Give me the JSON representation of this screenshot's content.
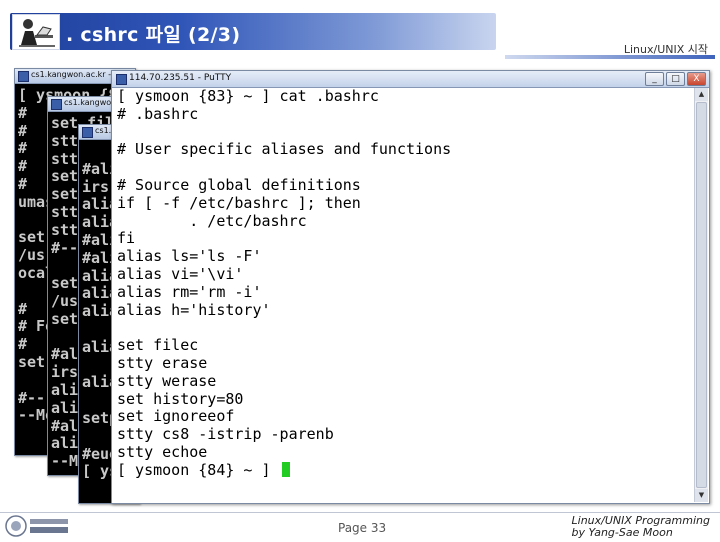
{
  "slide": {
    "title": ". cshrc 파일 (2/3)",
    "course": "Linux/UNIX 시작",
    "page": "Page 33",
    "credit_line1": "Linux/UNIX Programming",
    "credit_line2": "by Yang-Sae Moon"
  },
  "back_windows": [
    {
      "title": "cs1.kangwon.ac.kr - PuTTY",
      "lines": [
        "[ ysmoon {8",
        "#",
        "#",
        "#",
        "#",
        "#",
        "umas",
        "",
        "set",
        "/us",
        "ocal",
        "",
        "#",
        "# Fo",
        "#",
        "set",
        "",
        "#--",
        "--Mo"
      ]
    },
    {
      "title": "cs1.kangwon.ac.kr - PuTTY",
      "lines": [
        "set fil",
        "stty",
        "stty",
        "set",
        "set",
        "stt",
        "stt",
        "#--",
        "",
        "set",
        "/us",
        "set",
        "",
        "#al",
        "irs",
        "ali",
        "ali",
        "#al",
        "ali",
        "--M"
      ]
    },
    {
      "title": "cs1.kangwon.ac.kr - PuTTY",
      "lines": [
        "",
        "#ali",
        "irs",
        "alia",
        "alia",
        "#ali",
        "#ali",
        "alia",
        "alia",
        "alia",
        "",
        "alia",
        "",
        "alia",
        "",
        "setp",
        "",
        "#eue",
        "[ ys"
      ]
    }
  ],
  "main_window": {
    "title": "114.70.235.51 - PuTTY",
    "controls": [
      "_",
      "□",
      "X"
    ],
    "lines": [
      "[ ysmoon {83} ~ ] cat .bashrc",
      "# .bashrc",
      "",
      "# User specific aliases and functions",
      "",
      "# Source global definitions",
      "if [ -f /etc/bashrc ]; then",
      "        . /etc/bashrc",
      "fi",
      "alias ls='ls -F'",
      "alias vi='\\vi'",
      "alias rm='rm -i'",
      "alias h='history'",
      "",
      "set filec",
      "stty erase",
      "stty werase",
      "set history=80",
      "set ignoreeof",
      "stty cs8 -istrip -parenb",
      "stty echoe",
      "[ ysmoon {84} ~ ] "
    ]
  }
}
